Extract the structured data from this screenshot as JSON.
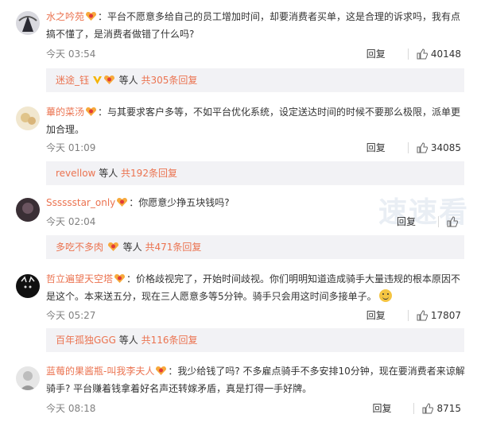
{
  "comments": [
    {
      "username": "水之吟苑",
      "text": "：平台不愿意多给自己的员工增加时间，却要消费者买单，这是合理的诉求吗，我有点搞不懂了，是消费者做错了什么吗?",
      "time": "今天 03:54",
      "reply_label": "回复",
      "likes": "40148",
      "thread": {
        "user": "迷途_钰",
        "middle": "等人",
        "link": "共305条回复"
      }
    },
    {
      "username": "蓽的菜汤",
      "text": "：与其要求客户多等，不如平台优化系统，设定送达时间的时候不要那么极限，派单更加合理。",
      "time": "今天 01:09",
      "reply_label": "回复",
      "likes": "34085",
      "thread": {
        "user": "revellow",
        "middle": "等人",
        "link": "共192条回复"
      }
    },
    {
      "username": "Sssssstar_only",
      "text": "：你愿意少挣五块钱吗?",
      "time": "今天 02:04",
      "reply_label": "回复",
      "likes": "",
      "thread": {
        "user": "多吃不多肉",
        "middle": "等人",
        "link": "共471条回复"
      }
    },
    {
      "username": "哲立遍望天空塔",
      "text": "：价格歧视完了，开始时间歧视。你们明明知道造成骑手大量违规的根本原因不是这个。本来送五分，现在三人愿意多等5分钟。骑手只会用这时间多接单子。",
      "time": "今天 05:27",
      "reply_label": "回复",
      "likes": "17807",
      "thread": {
        "user": "百年孤独GGG",
        "middle": "等人",
        "link": "共116条回复"
      }
    },
    {
      "username": "蓝莓的果酱瓶-叫我李夫人",
      "text": "：我少给钱了吗? 不多雇点骑手不多安排10分钟，现在要消费者来谅解骑手? 平台赚着钱拿着好名声还转嫁矛盾，真是打得一手好牌。",
      "time": "今天 08:18",
      "reply_label": "回复",
      "likes": "8715"
    }
  ],
  "watermark": "速速看",
  "colors": {
    "username": "#eb7350",
    "thread_bg": "#f2f2f5",
    "meta": "#808080"
  }
}
